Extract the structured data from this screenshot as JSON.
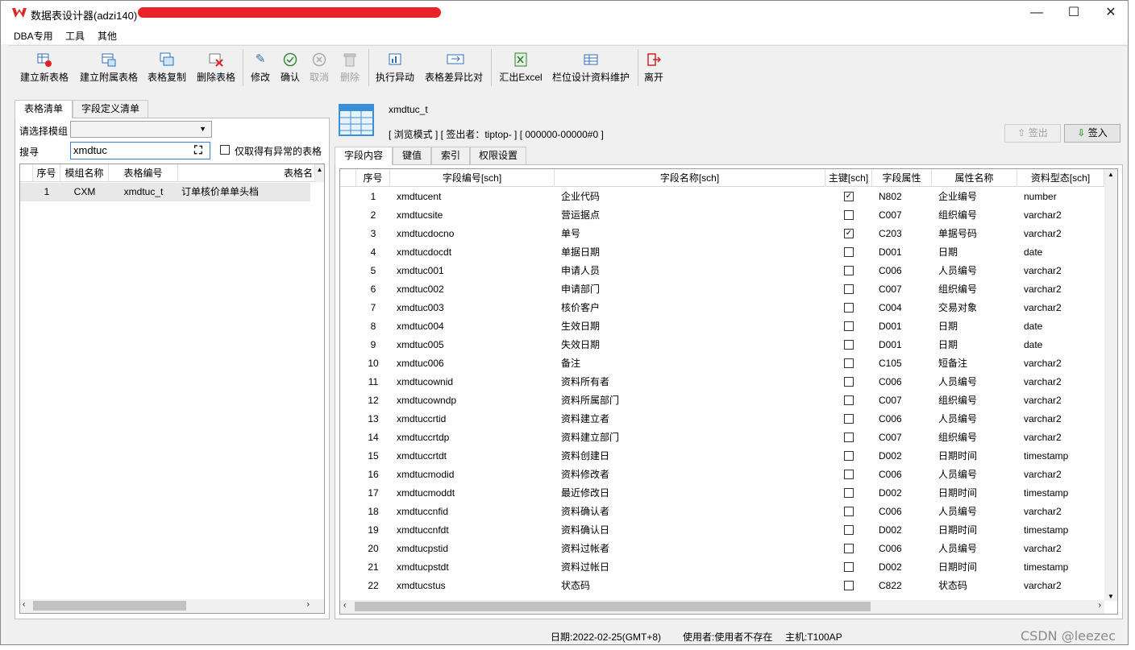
{
  "window": {
    "title": "数据表设计器(adzi140)",
    "minimize": "—",
    "maximize": "☐",
    "close": "✕"
  },
  "menu": [
    "DBA专用",
    "工具",
    "其他"
  ],
  "toolbar": [
    {
      "label": "建立新表格",
      "icon": "new-table-icon",
      "enabled": true
    },
    {
      "label": "建立附属表格",
      "icon": "sub-table-icon",
      "enabled": true
    },
    {
      "label": "表格复制",
      "icon": "copy-table-icon",
      "enabled": true
    },
    {
      "label": "删除表格",
      "icon": "delete-table-icon",
      "enabled": true
    },
    {
      "label": "修改",
      "icon": "pencil-icon",
      "enabled": true
    },
    {
      "label": "确认",
      "icon": "check-icon",
      "enabled": true
    },
    {
      "label": "取消",
      "icon": "cancel-icon",
      "enabled": false
    },
    {
      "label": "删除",
      "icon": "trash-icon",
      "enabled": false
    },
    {
      "label": "执行异动",
      "icon": "run-icon",
      "enabled": true
    },
    {
      "label": "表格差异比对",
      "icon": "compare-icon",
      "enabled": true
    },
    {
      "label": "汇出Excel",
      "icon": "excel-icon",
      "enabled": true
    },
    {
      "label": "栏位设计资料维护",
      "icon": "field-maintain-icon",
      "enabled": true
    },
    {
      "label": "离开",
      "icon": "exit-icon",
      "enabled": true
    }
  ],
  "left": {
    "tabs": [
      "表格清单",
      "字段定义清单"
    ],
    "module_label": "请选择模组",
    "module_value": "",
    "search_label": "搜寻",
    "search_value": "xmdtuc",
    "abnormal_label": "仅取得有异常的表格",
    "columns": [
      "序号",
      "模组名称",
      "表格编号",
      "表格名"
    ],
    "rows": [
      {
        "no": "1",
        "module": "CXM",
        "table": "xmdtuc_t",
        "name": "订单核价单单头档"
      }
    ]
  },
  "right": {
    "table_name": "xmdtuc_t",
    "mode_text": "[ 浏览模式 ] [ 签出者：tiptop-  ] [ 000000-00000#0 ]",
    "checkout_label": "签出",
    "checkin_label": "签入",
    "tabs": [
      "字段内容",
      "键值",
      "索引",
      "权限设置"
    ],
    "columns": [
      "序号",
      "字段编号[sch]",
      "字段名称[sch]",
      "主键[sch]",
      "字段属性",
      "属性名称",
      "资料型态[sch]"
    ],
    "rows": [
      {
        "no": "1",
        "code": "xmdtucent",
        "name": "企业代码",
        "pk": true,
        "attr": "N802",
        "attr_name": "企业编号",
        "type": "number"
      },
      {
        "no": "2",
        "code": "xmdtucsite",
        "name": "营运据点",
        "pk": false,
        "attr": "C007",
        "attr_name": "组织编号",
        "type": "varchar2"
      },
      {
        "no": "3",
        "code": "xmdtucdocno",
        "name": "单号",
        "pk": true,
        "attr": "C203",
        "attr_name": "单据号码",
        "type": "varchar2"
      },
      {
        "no": "4",
        "code": "xmdtucdocdt",
        "name": "单据日期",
        "pk": false,
        "attr": "D001",
        "attr_name": "日期",
        "type": "date"
      },
      {
        "no": "5",
        "code": "xmdtuc001",
        "name": "申请人员",
        "pk": false,
        "attr": "C006",
        "attr_name": "人员编号",
        "type": "varchar2"
      },
      {
        "no": "6",
        "code": "xmdtuc002",
        "name": "申请部门",
        "pk": false,
        "attr": "C007",
        "attr_name": "组织编号",
        "type": "varchar2"
      },
      {
        "no": "7",
        "code": "xmdtuc003",
        "name": "核价客户",
        "pk": false,
        "attr": "C004",
        "attr_name": "交易对象",
        "type": "varchar2"
      },
      {
        "no": "8",
        "code": "xmdtuc004",
        "name": "生效日期",
        "pk": false,
        "attr": "D001",
        "attr_name": "日期",
        "type": "date"
      },
      {
        "no": "9",
        "code": "xmdtuc005",
        "name": "失效日期",
        "pk": false,
        "attr": "D001",
        "attr_name": "日期",
        "type": "date"
      },
      {
        "no": "10",
        "code": "xmdtuc006",
        "name": "备注",
        "pk": false,
        "attr": "C105",
        "attr_name": "短备注",
        "type": "varchar2"
      },
      {
        "no": "11",
        "code": "xmdtucownid",
        "name": "资料所有者",
        "pk": false,
        "attr": "C006",
        "attr_name": "人员编号",
        "type": "varchar2"
      },
      {
        "no": "12",
        "code": "xmdtucowndp",
        "name": "资料所属部门",
        "pk": false,
        "attr": "C007",
        "attr_name": "组织编号",
        "type": "varchar2"
      },
      {
        "no": "13",
        "code": "xmdtuccrtid",
        "name": "资料建立者",
        "pk": false,
        "attr": "C006",
        "attr_name": "人员编号",
        "type": "varchar2"
      },
      {
        "no": "14",
        "code": "xmdtuccrtdp",
        "name": "资料建立部门",
        "pk": false,
        "attr": "C007",
        "attr_name": "组织编号",
        "type": "varchar2"
      },
      {
        "no": "15",
        "code": "xmdtuccrtdt",
        "name": "资料创建日",
        "pk": false,
        "attr": "D002",
        "attr_name": "日期时间",
        "type": "timestamp"
      },
      {
        "no": "16",
        "code": "xmdtucmodid",
        "name": "资料修改者",
        "pk": false,
        "attr": "C006",
        "attr_name": "人员编号",
        "type": "varchar2"
      },
      {
        "no": "17",
        "code": "xmdtucmoddt",
        "name": "最近修改日",
        "pk": false,
        "attr": "D002",
        "attr_name": "日期时间",
        "type": "timestamp"
      },
      {
        "no": "18",
        "code": "xmdtuccnfid",
        "name": "资料确认者",
        "pk": false,
        "attr": "C006",
        "attr_name": "人员编号",
        "type": "varchar2"
      },
      {
        "no": "19",
        "code": "xmdtuccnfdt",
        "name": "资料确认日",
        "pk": false,
        "attr": "D002",
        "attr_name": "日期时间",
        "type": "timestamp"
      },
      {
        "no": "20",
        "code": "xmdtucpstid",
        "name": "资料过帐者",
        "pk": false,
        "attr": "C006",
        "attr_name": "人员编号",
        "type": "varchar2"
      },
      {
        "no": "21",
        "code": "xmdtucpstdt",
        "name": "资料过帐日",
        "pk": false,
        "attr": "D002",
        "attr_name": "日期时间",
        "type": "timestamp"
      },
      {
        "no": "22",
        "code": "xmdtucstus",
        "name": "状态码",
        "pk": false,
        "attr": "C822",
        "attr_name": "状态码",
        "type": "varchar2"
      }
    ]
  },
  "status": {
    "date": "日期:2022-02-25(GMT+8)",
    "user": "使用者:使用者不存在",
    "host": "主机:T100AP"
  },
  "watermark": "CSDN @leezec"
}
